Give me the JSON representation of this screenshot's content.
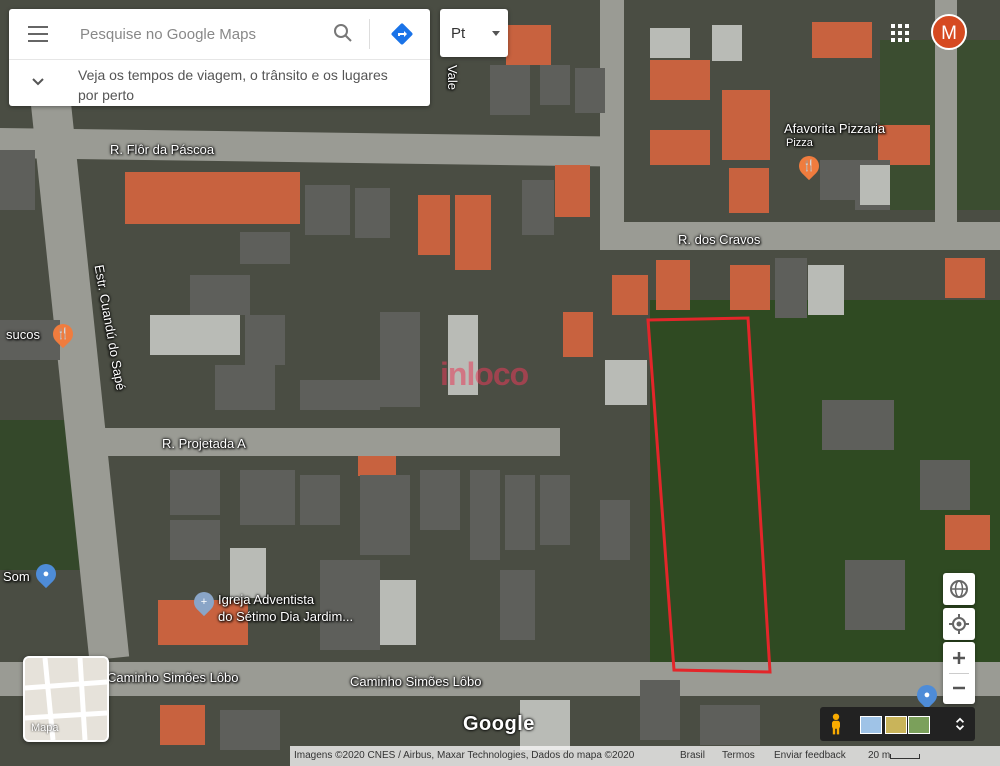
{
  "search": {
    "placeholder": "Pesquise no Google Maps",
    "hint": "Veja os tempos de viagem, o trânsito e os lugares por perto"
  },
  "layer_toggle": {
    "label": "Pt"
  },
  "account": {
    "initial": "M",
    "color": "#d64a21"
  },
  "roads": {
    "flor_pascoa": "R. Flôr da Páscoa",
    "cravos": "R. dos Cravos",
    "projetada": "R. Projetada A",
    "cuandu": "Estr. Cuandú do Sapé",
    "simoes_left": "Caminho Simões Lôbo",
    "simoes_center": "Caminho Simões Lôbo",
    "vale": "Vale"
  },
  "places": {
    "pizzaria": "Afavorita Pizzaria",
    "pizzaria_type": "Pizza",
    "sucos": "sucos",
    "igreja_line1": "Igreja Adventista",
    "igreja_line2": "do Sétimo Dia Jardim...",
    "som": "Som"
  },
  "watermark": "inloco",
  "minimap": {
    "label": "Mapa"
  },
  "google_logo": "Google",
  "footer": {
    "attribution": "Imagens ©2020 CNES / Airbus, Maxar Technologies, Dados do mapa ©2020",
    "country": "Brasil",
    "terms": "Termos",
    "feedback": "Enviar feedback",
    "scale": "20 m"
  },
  "colors": {
    "highlight": "#e3262a",
    "pin_orange": "#f07c3e",
    "pin_blue": "#4e8cd8"
  }
}
